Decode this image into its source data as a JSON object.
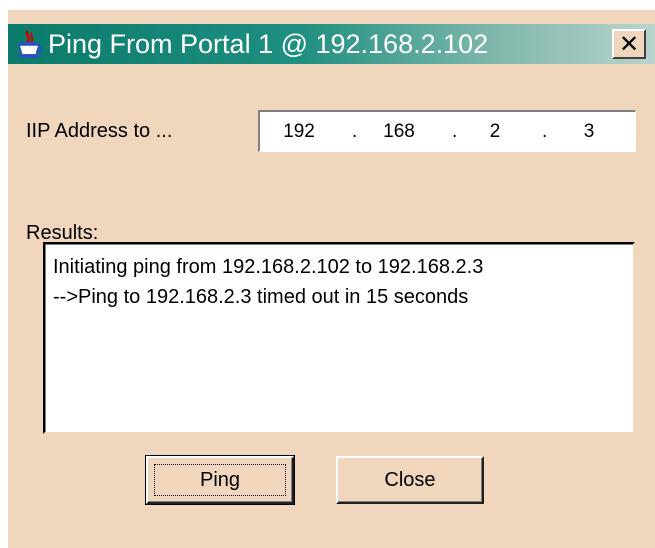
{
  "window": {
    "title": "Ping From Portal 1 @ 192.168.2.102",
    "close_glyph": "✕",
    "icon": "java-cup-icon"
  },
  "form": {
    "ip_label": "IIP Address to ...",
    "ip_octets": [
      "192",
      "168",
      "2",
      "3"
    ],
    "ip_separator": "."
  },
  "results": {
    "label": "Results:",
    "lines": [
      "Initiating ping from 192.168.2.102 to 192.168.2.3",
      "-->Ping to 192.168.2.3 timed out in 15 seconds"
    ]
  },
  "buttons": {
    "ping_label": "Ping",
    "close_label": "Close"
  },
  "colors": {
    "dialog_background": "#efd6bd",
    "titlebar_start": "#0a7a6b",
    "titlebar_end": "#b9d4cc"
  }
}
